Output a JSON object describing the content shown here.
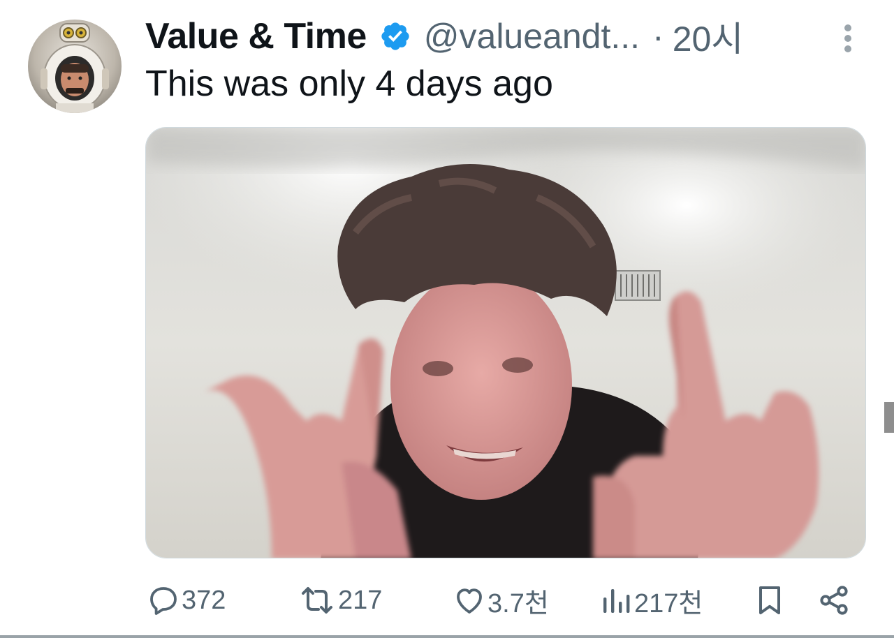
{
  "author": {
    "display_name": "Value & Time",
    "handle": "@valueandt...",
    "separator": "·",
    "time": "20시",
    "verified": true,
    "avatar_icon": "astronaut-avatar"
  },
  "tweet": {
    "text": "This was only 4 days ago",
    "media_alt_icon": "photo-kid-gesturing"
  },
  "actions": {
    "replies": "372",
    "retweets": "217",
    "likes": "3.7천",
    "views": "217천"
  },
  "colors": {
    "text_primary": "#0f1419",
    "text_secondary": "#536471",
    "verified_blue": "#1d9bf0"
  }
}
